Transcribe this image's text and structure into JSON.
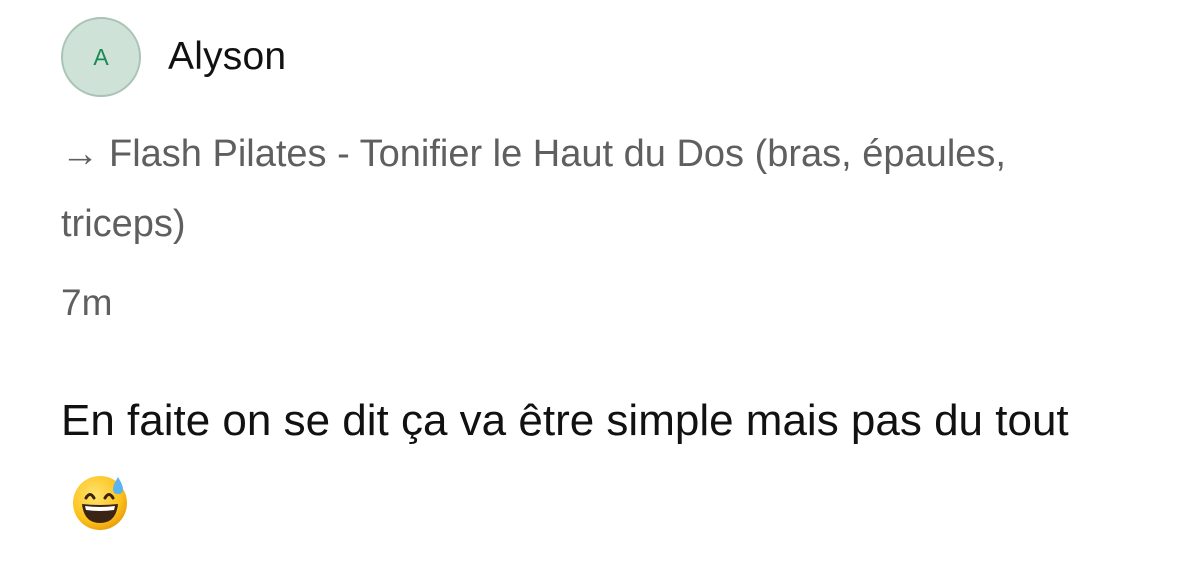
{
  "comment": {
    "avatar_initial": "A",
    "author_name": "Alyson",
    "context_arrow": "→",
    "context_title": "Flash Pilates - Tonifier le Haut du Dos (bras, épaules, triceps)",
    "timestamp": "7m",
    "body": "En faite on se dit ça va être simple mais pas du tout",
    "emoji_icon": "grinning-face-with-sweat-icon"
  },
  "colors": {
    "avatar_bg": "#cfe2d8",
    "avatar_text": "#1a8a52",
    "secondary_text": "#5f5f5f",
    "primary_text": "#111111"
  }
}
